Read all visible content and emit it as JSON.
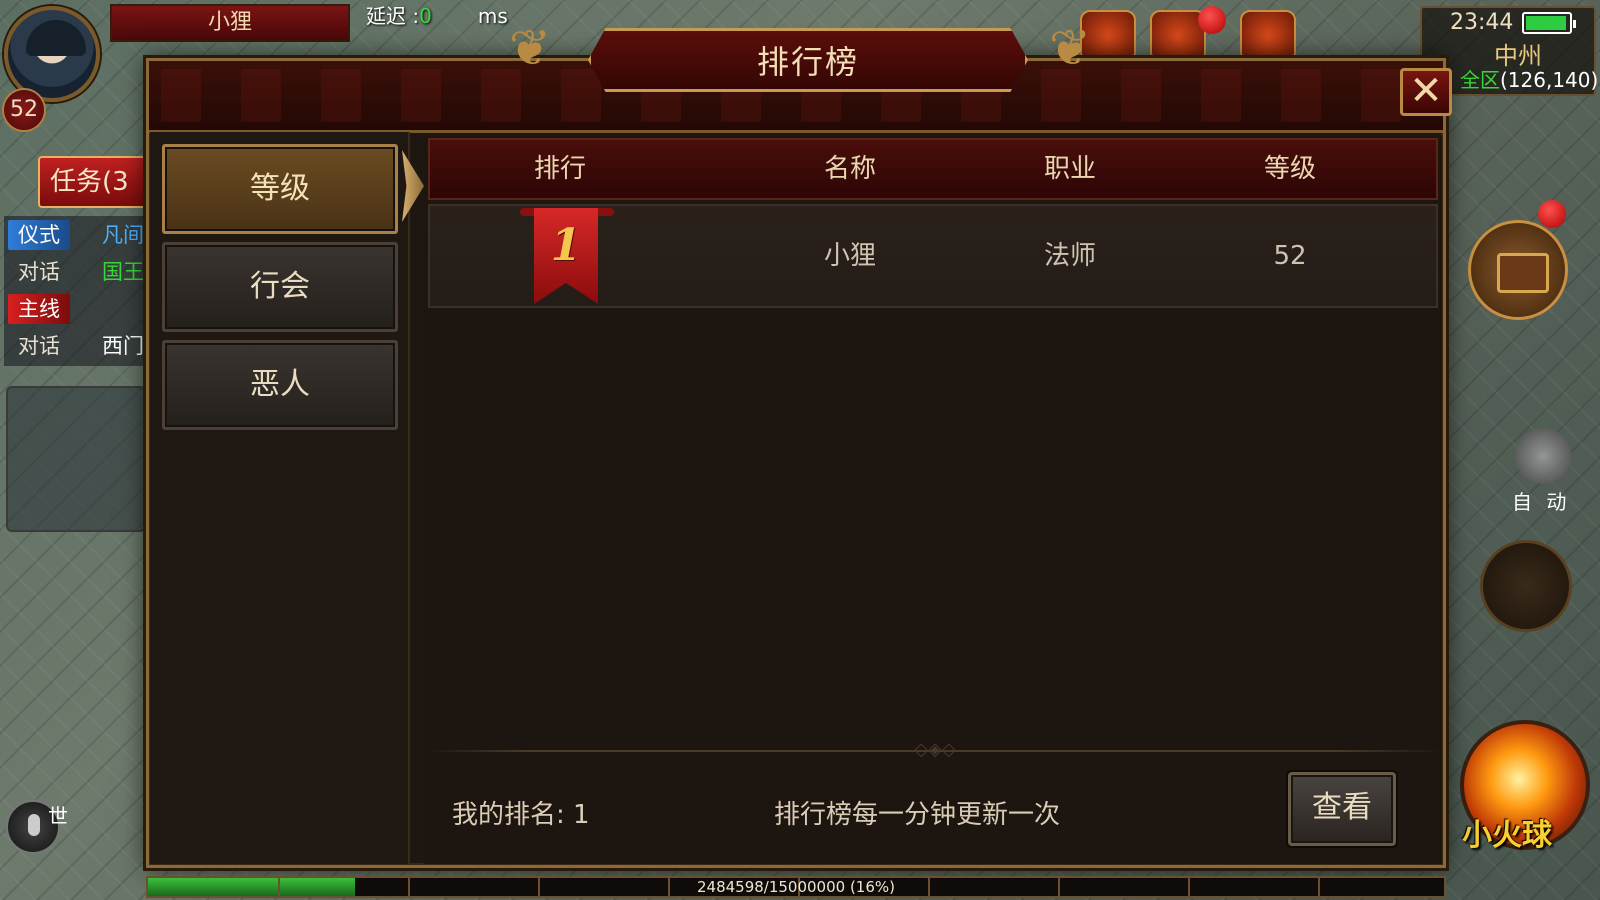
{
  "hud": {
    "player_name": "小狸",
    "player_level": "52",
    "latency_label": "延迟 :",
    "latency_value": "0",
    "latency_unit": "ms",
    "task_button": "任务(3",
    "quests": [
      {
        "tag": "仪式",
        "text": "凡间"
      },
      {
        "tag": "对话",
        "text": "国王"
      },
      {
        "tag": "主线",
        "text": ""
      },
      {
        "tag": "对话",
        "text": "西门"
      }
    ],
    "world_channel": "世",
    "time": "23:44",
    "zone": "中州",
    "safe_zone": "全区",
    "coords": "(126,140)",
    "auto_label": "自 动",
    "skill_name": "小火球",
    "battery_percent": 80
  },
  "panel": {
    "title": "排行榜",
    "close_label": "✕",
    "tabs": [
      {
        "label": "等级",
        "active": true
      },
      {
        "label": "行会",
        "active": false
      },
      {
        "label": "恶人",
        "active": false
      }
    ],
    "columns": [
      "排行",
      "名称",
      "职业",
      "等级"
    ],
    "rows": [
      {
        "rank": "1",
        "name": "小狸",
        "class": "法师",
        "level": "52"
      }
    ],
    "my_rank": "我的排名: 1",
    "notice": "排行榜每一分钟更新一次",
    "view_button": "查看"
  },
  "exp": {
    "text": "2484598/15000000 (16%)",
    "fraction": 0.16
  },
  "colors": {
    "panel_bg": "#1d1611",
    "header_red": "#4a0e0a",
    "gold_border": "#b88a44",
    "rank_ribbon": "#d82828",
    "rank_number": "#f4c84e"
  }
}
